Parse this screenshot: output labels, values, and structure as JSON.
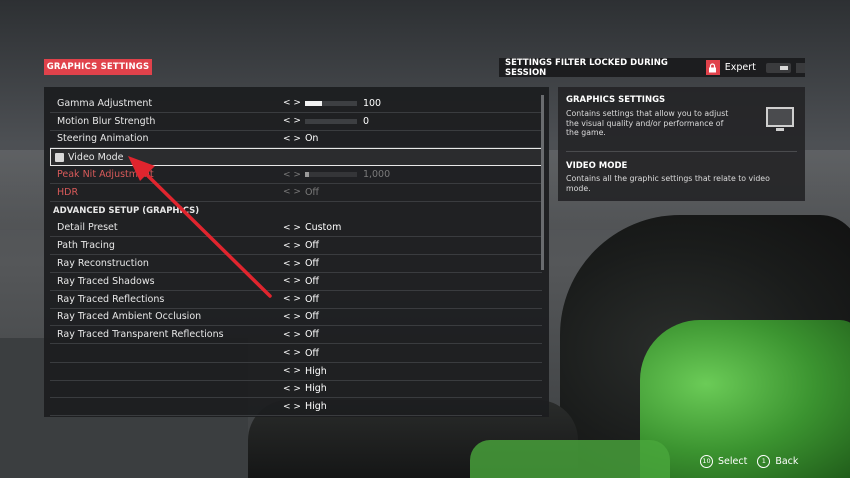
{
  "header": {
    "title": "GRAPHICS SETTINGS"
  },
  "filter_bar": {
    "label": "SETTINGS FILTER LOCKED DURING SESSION",
    "level": "Expert",
    "lock_icon": "lock-icon"
  },
  "settings": {
    "rows": [
      {
        "label": "Gamma Adjustment",
        "value": "100",
        "slider": 0.33
      },
      {
        "label": "Motion Blur Strength",
        "value": "0",
        "slider": 0.0
      },
      {
        "label": "Steering Animation",
        "value": "On"
      },
      {
        "label": "Video Mode"
      },
      {
        "label": "Peak Nit Adjustment",
        "value": "1,000",
        "slider": 0.08
      },
      {
        "label": "HDR",
        "value": "Off"
      },
      {
        "label": "ADVANCED SETUP (GRAPHICS)"
      },
      {
        "label": "Detail Preset",
        "value": "Custom"
      },
      {
        "label": "Path Tracing",
        "value": "Off"
      },
      {
        "label": "Ray Reconstruction",
        "value": "Off"
      },
      {
        "label": "Ray Traced Shadows",
        "value": "Off"
      },
      {
        "label": "Ray Traced Reflections",
        "value": "Off"
      },
      {
        "label": "Ray Traced Ambient Occlusion",
        "value": "Off"
      },
      {
        "label": "Ray Traced Transparent Reflections",
        "value": "Off"
      }
    ],
    "hidden_rows": [
      {
        "value": "Off"
      },
      {
        "value": "High"
      },
      {
        "value": "High"
      },
      {
        "value": "High"
      }
    ],
    "arrows": "< >"
  },
  "info": {
    "title1": "GRAPHICS SETTINGS",
    "text1": "Contains settings that allow you to adjust the visual quality and/or performance of the game.",
    "title2": "VIDEO MODE",
    "text2": "Contains all the graphic settings that relate to video mode.",
    "icon": "monitor-icon"
  },
  "footer": {
    "select_btn": "10",
    "select_label": "Select",
    "back_btn": "1",
    "back_label": "Back"
  },
  "colors": {
    "accent": "#e0424b",
    "annotation_arrow": "#e0252e"
  }
}
